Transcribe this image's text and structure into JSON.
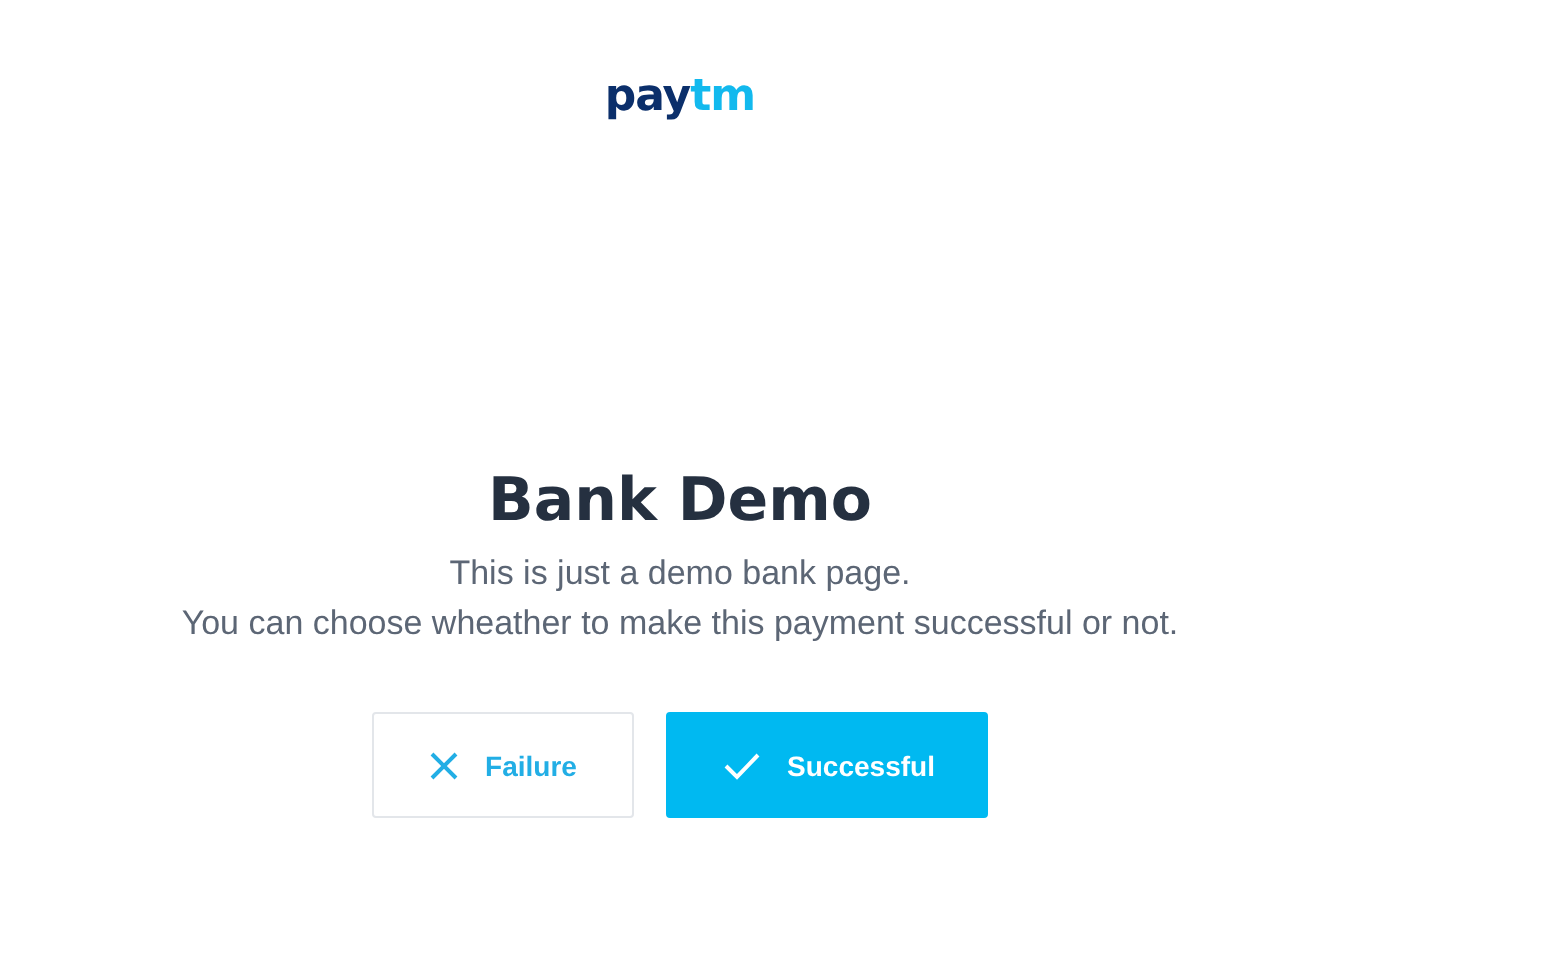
{
  "logo": [
    {
      "text": "pay",
      "color": "#0b2f6b"
    },
    {
      "text": "tm",
      "color": "#12b9ee"
    }
  ],
  "title": "Bank Demo",
  "description": [
    "This is just a demo bank page.",
    "You can choose wheather to make this payment successful or not."
  ],
  "buttons": [
    {
      "kind": "failure",
      "label": "Failure"
    },
    {
      "kind": "success",
      "label": "Successful"
    }
  ]
}
